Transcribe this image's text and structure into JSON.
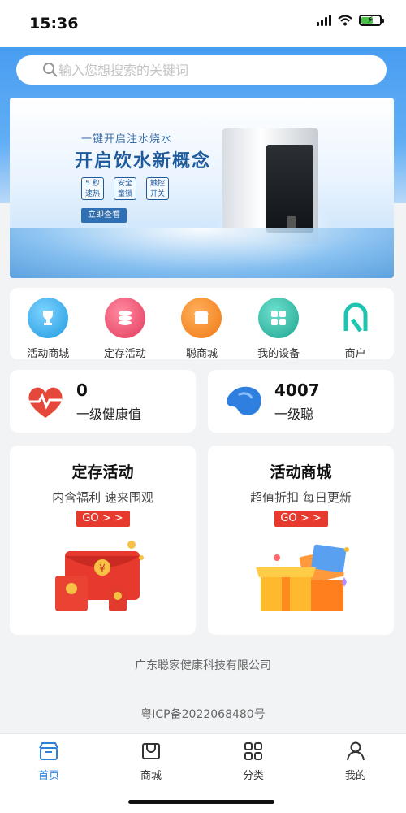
{
  "status": {
    "time": "15:36"
  },
  "search": {
    "placeholder": "输入您想搜索的关键词"
  },
  "banner": {
    "tagline": "一键开启注水烧水",
    "title": "开启饮水新概念",
    "features": [
      {
        "line1": "5 秒",
        "line2": "速热"
      },
      {
        "line1": "安全",
        "line2": "童锁"
      },
      {
        "line1": "触控",
        "line2": "开关"
      }
    ],
    "button": "立即查看"
  },
  "nav": [
    {
      "label": "活动商城",
      "icon": "trophy-icon",
      "color": "#2fa6e6"
    },
    {
      "label": "定存活动",
      "icon": "coins-icon",
      "color": "#ef4d6a"
    },
    {
      "label": "聪商城",
      "icon": "shop-icon",
      "color": "#f5861f"
    },
    {
      "label": "我的设备",
      "icon": "grid-icon",
      "color": "#2bb5a0"
    },
    {
      "label": "商户",
      "icon": "merchant-icon",
      "color": "#1fc4b0"
    }
  ],
  "stats": [
    {
      "value": "0",
      "label": "一级健康值",
      "icon": "heart-pulse-icon"
    },
    {
      "value": "4007",
      "label": "一级聪",
      "icon": "bean-icon"
    }
  ],
  "promos": [
    {
      "title": "定存活动",
      "subtitle": "内含福利 速来围观",
      "go": "GO > >",
      "image": "red-envelope-icon"
    },
    {
      "title": "活动商城",
      "subtitle": "超值折扣 每日更新",
      "go": "GO > >",
      "image": "gift-box-icon"
    }
  ],
  "footer": {
    "company": "广东聪家健康科技有限公司",
    "icp": "粤ICP备2022068480号"
  },
  "tabs": [
    {
      "label": "首页",
      "icon": "home-store-icon",
      "active": true
    },
    {
      "label": "商城",
      "icon": "mall-icon",
      "active": false
    },
    {
      "label": "分类",
      "icon": "category-icon",
      "active": false
    },
    {
      "label": "我的",
      "icon": "user-icon",
      "active": false
    }
  ],
  "colors": {
    "primary": "#3c95f0",
    "accent": "#e63a2e",
    "active_tab": "#2d7fd8"
  }
}
